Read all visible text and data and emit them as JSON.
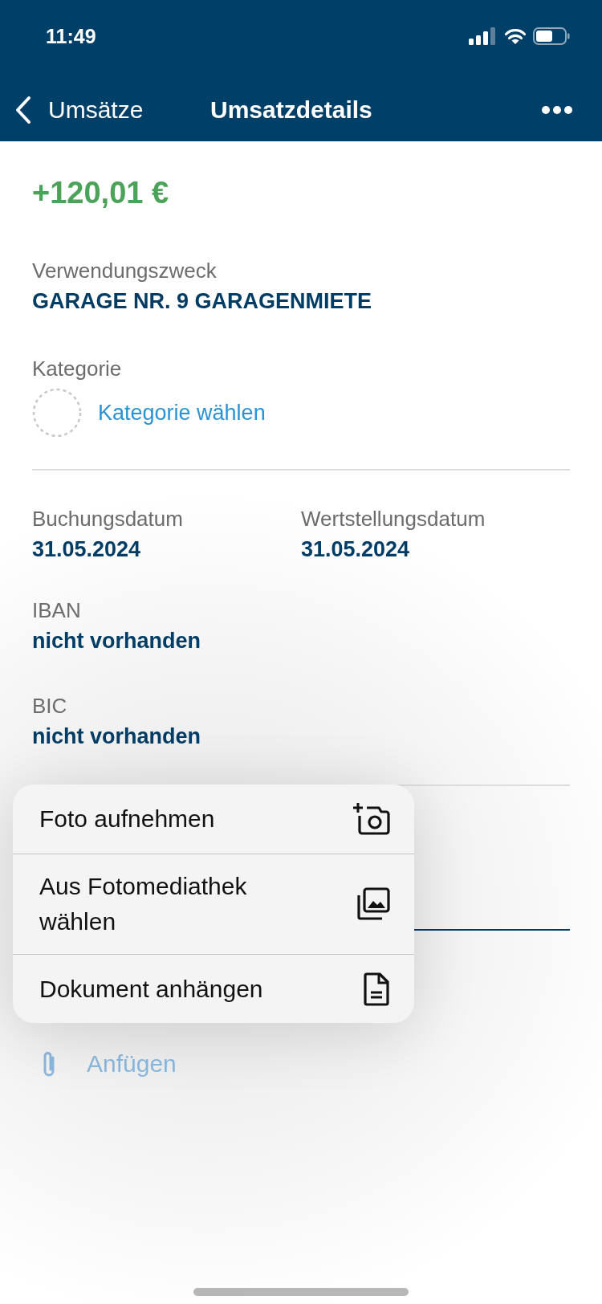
{
  "status_bar": {
    "time": "11:49"
  },
  "nav": {
    "back_label": "Umsätze",
    "title": "Umsatzdetails"
  },
  "amount": {
    "text": "+120,01 €",
    "kind": "credit"
  },
  "purpose": {
    "label": "Verwendungszweck",
    "value": "GARAGE NR. 9 GARAGENMIETE"
  },
  "category": {
    "label": "Kategorie",
    "action": "Kategorie wählen"
  },
  "dates": [
    {
      "label": "Buchungsdatum",
      "value": "31.05.2024"
    },
    {
      "label": "Wertstellungsdatum",
      "value": "31.05.2024"
    }
  ],
  "details": [
    {
      "label": "IBAN",
      "value": "nicht vorhanden"
    },
    {
      "label": "BIC",
      "value": "nicht vorhanden"
    }
  ],
  "attach": {
    "label": "Anfügen"
  },
  "menu": {
    "items": [
      {
        "label": "Foto aufnehmen",
        "kind": "camera"
      },
      {
        "label": "Aus Fotomediathek wählen",
        "kind": "library"
      },
      {
        "label": "Dokument anhängen",
        "kind": "document"
      }
    ]
  }
}
